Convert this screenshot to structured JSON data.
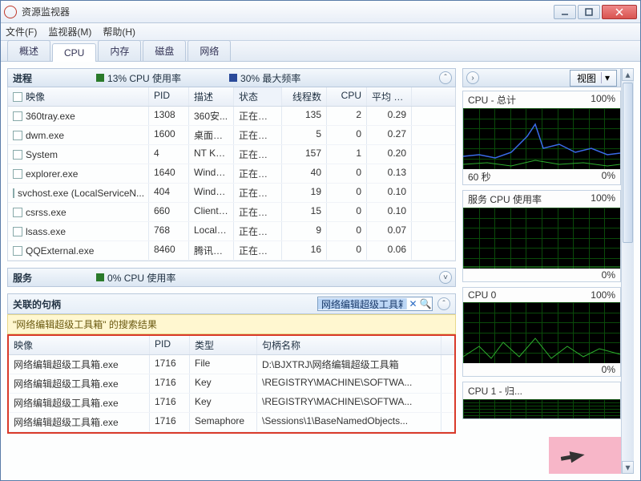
{
  "window": {
    "title": "资源监视器"
  },
  "menu": {
    "file": "文件(F)",
    "monitor": "监视器(M)",
    "help": "帮助(H)"
  },
  "tabs": [
    {
      "label": "概述"
    },
    {
      "label": "CPU"
    },
    {
      "label": "内存"
    },
    {
      "label": "磁盘"
    },
    {
      "label": "网络"
    }
  ],
  "processes": {
    "title": "进程",
    "cpu_stat": "13% CPU 使用率",
    "freq_stat": "30% 最大频率",
    "columns": {
      "image": "映像",
      "pid": "PID",
      "desc": "描述",
      "status": "状态",
      "threads": "线程数",
      "cpu": "CPU",
      "avg": "平均 C..."
    },
    "rows": [
      {
        "image": "360tray.exe",
        "pid": "1308",
        "desc": "360安...",
        "status": "正在运行",
        "threads": "135",
        "cpu": "2",
        "avg": "0.29"
      },
      {
        "image": "dwm.exe",
        "pid": "1600",
        "desc": "桌面窗...",
        "status": "正在运行",
        "threads": "5",
        "cpu": "0",
        "avg": "0.27"
      },
      {
        "image": "System",
        "pid": "4",
        "desc": "NT Ker...",
        "status": "正在运行",
        "threads": "157",
        "cpu": "1",
        "avg": "0.20"
      },
      {
        "image": "explorer.exe",
        "pid": "1640",
        "desc": "Windo...",
        "status": "正在运行",
        "threads": "40",
        "cpu": "0",
        "avg": "0.13"
      },
      {
        "image": "svchost.exe (LocalServiceN...",
        "pid": "404",
        "desc": "Windo...",
        "status": "正在运行",
        "threads": "19",
        "cpu": "0",
        "avg": "0.10"
      },
      {
        "image": "csrss.exe",
        "pid": "660",
        "desc": "Client ...",
        "status": "正在运行",
        "threads": "15",
        "cpu": "0",
        "avg": "0.10"
      },
      {
        "image": "lsass.exe",
        "pid": "768",
        "desc": "Local S...",
        "status": "正在运行",
        "threads": "9",
        "cpu": "0",
        "avg": "0.07"
      },
      {
        "image": "QQExternal.exe",
        "pid": "8460",
        "desc": "腾讯Q...",
        "status": "正在运行",
        "threads": "16",
        "cpu": "0",
        "avg": "0.06"
      }
    ]
  },
  "services": {
    "title": "服务",
    "cpu_stat": "0% CPU 使用率"
  },
  "handles": {
    "title": "关联的句柄",
    "search_value": "网络编辑超级工具箱",
    "result_label": "\"网络编辑超级工具箱\" 的搜索结果",
    "columns": {
      "image": "映像",
      "pid": "PID",
      "type": "类型",
      "name": "句柄名称"
    },
    "rows": [
      {
        "image": "网络编辑超级工具箱.exe",
        "pid": "1716",
        "type": "File",
        "name": "D:\\BJXTRJ\\网络编辑超级工具箱"
      },
      {
        "image": "网络编辑超级工具箱.exe",
        "pid": "1716",
        "type": "Key",
        "name": "\\REGISTRY\\MACHINE\\SOFTWA..."
      },
      {
        "image": "网络编辑超级工具箱.exe",
        "pid": "1716",
        "type": "Key",
        "name": "\\REGISTRY\\MACHINE\\SOFTWA..."
      },
      {
        "image": "网络编辑超级工具箱.exe",
        "pid": "1716",
        "type": "Semaphore",
        "name": "\\Sessions\\1\\BaseNamedObjects..."
      }
    ]
  },
  "right": {
    "view_btn": "视图",
    "charts": [
      {
        "title": "CPU - 总计",
        "right": "100%",
        "foot_l": "60 秒",
        "foot_r": "0%"
      },
      {
        "title": "服务 CPU 使用率",
        "right": "100%",
        "foot_l": "",
        "foot_r": "0%"
      },
      {
        "title": "CPU 0",
        "right": "100%",
        "foot_l": "",
        "foot_r": "0%"
      },
      {
        "title": "CPU 1 - 归...",
        "right": "",
        "foot_l": "",
        "foot_r": ""
      }
    ]
  }
}
